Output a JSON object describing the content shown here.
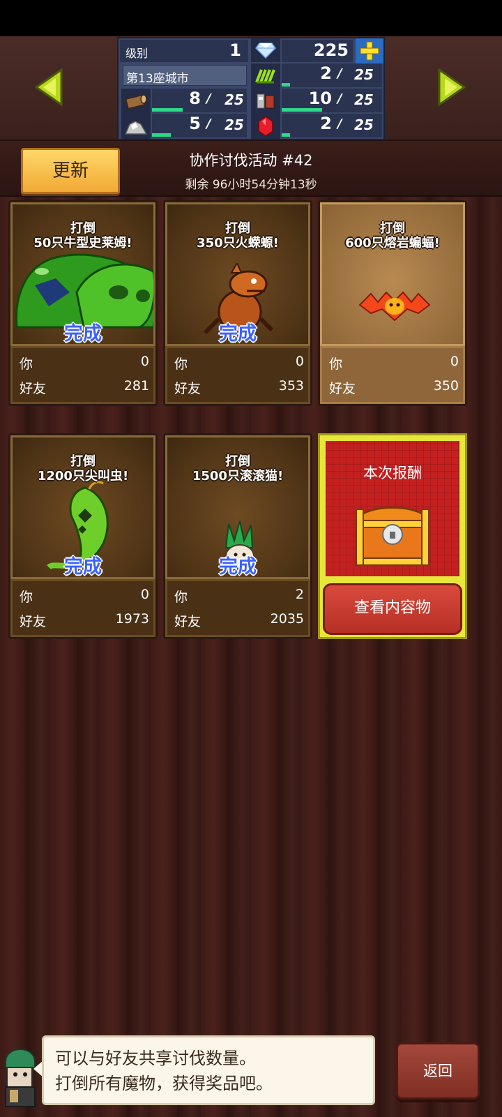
{
  "stats": {
    "level_label": "级别",
    "level_value": "1",
    "gems": "225",
    "city_label": "第13座城市",
    "r_herb": {
      "value": "2",
      "max": "25",
      "fill": 0.08
    },
    "r_wood": {
      "value": "8",
      "max": "25",
      "fill": 0.32
    },
    "r_mineral": {
      "value": "10",
      "max": "25",
      "fill": 0.4
    },
    "r_ore": {
      "value": "5",
      "max": "25",
      "fill": 0.2
    },
    "r_ruby": {
      "value": "2",
      "max": "25",
      "fill": 0.08
    },
    "slash": "/"
  },
  "header": {
    "refresh_label": "更新",
    "event_title": "协作讨伐活动 #42",
    "timer": "剩余 96小时54分钟13秒"
  },
  "cards": [
    {
      "title_line1": "打倒",
      "title_line2": "50只牛型史莱姆!",
      "done": "完成",
      "you_label": "你",
      "you_value": "0",
      "friend_label": "好友",
      "friend_value": "281",
      "creature": "slime-icon"
    },
    {
      "title_line1": "打倒",
      "title_line2": "350只火蝾螈!",
      "done": "完成",
      "you_label": "你",
      "you_value": "0",
      "friend_label": "好友",
      "friend_value": "353",
      "creature": "salamander-icon"
    },
    {
      "title_line1": "打倒",
      "title_line2": "600只熔岩蝙蝠!",
      "done": "",
      "you_label": "你",
      "you_value": "0",
      "friend_label": "好友",
      "friend_value": "350",
      "creature": "bat-icon"
    },
    {
      "title_line1": "打倒",
      "title_line2": "1200只尖叫虫!",
      "done": "完成",
      "you_label": "你",
      "you_value": "0",
      "friend_label": "好友",
      "friend_value": "1973",
      "creature": "worm-icon"
    },
    {
      "title_line1": "打倒",
      "title_line2": "1500只滚滚猫!",
      "done": "完成",
      "you_label": "你",
      "you_value": "2",
      "friend_label": "好友",
      "friend_value": "2035",
      "creature": "leaf-cat-icon"
    }
  ],
  "reward": {
    "title": "本次报酬",
    "view_label": "查看内容物"
  },
  "dialog": {
    "line1": "可以与好友共享讨伐数量。",
    "line2": "打倒所有魔物，获得奖品吧。"
  },
  "back_label": "返回"
}
